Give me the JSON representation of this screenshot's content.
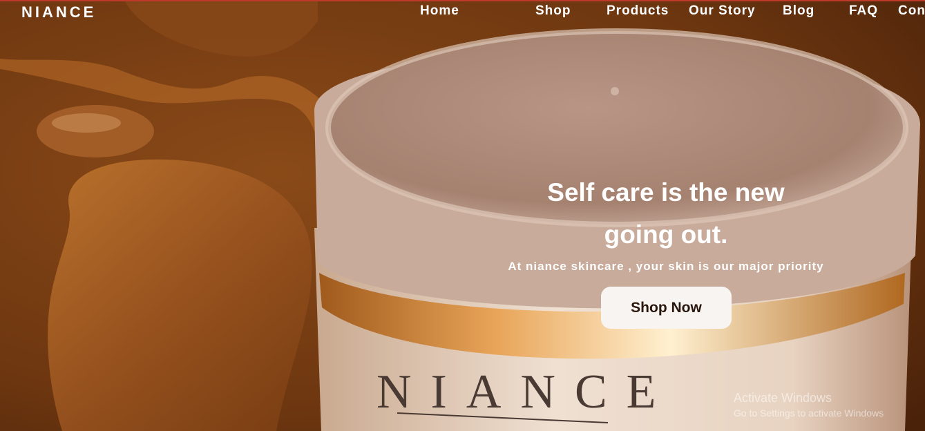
{
  "brand": "NIANCE",
  "nav": {
    "items": [
      {
        "label": "Home"
      },
      {
        "label": "Shop"
      },
      {
        "label": "Products"
      },
      {
        "label": "Our Story"
      },
      {
        "label": "Blog"
      },
      {
        "label": "FAQ"
      },
      {
        "label": "Con"
      }
    ]
  },
  "hero": {
    "headline_line1": "Self care is the new",
    "headline_line2": "going out.",
    "subtitle": "At niance skincare , your skin is our major priority",
    "cta_label": "Shop Now",
    "jar_label": "NIANCE"
  },
  "watermark": {
    "title": "Activate Windows",
    "subtitle": "Go to Settings to activate Windows"
  },
  "colors": {
    "background": "#6b3510",
    "button_bg": "#f7f4f2",
    "button_text": "#2a160c"
  }
}
